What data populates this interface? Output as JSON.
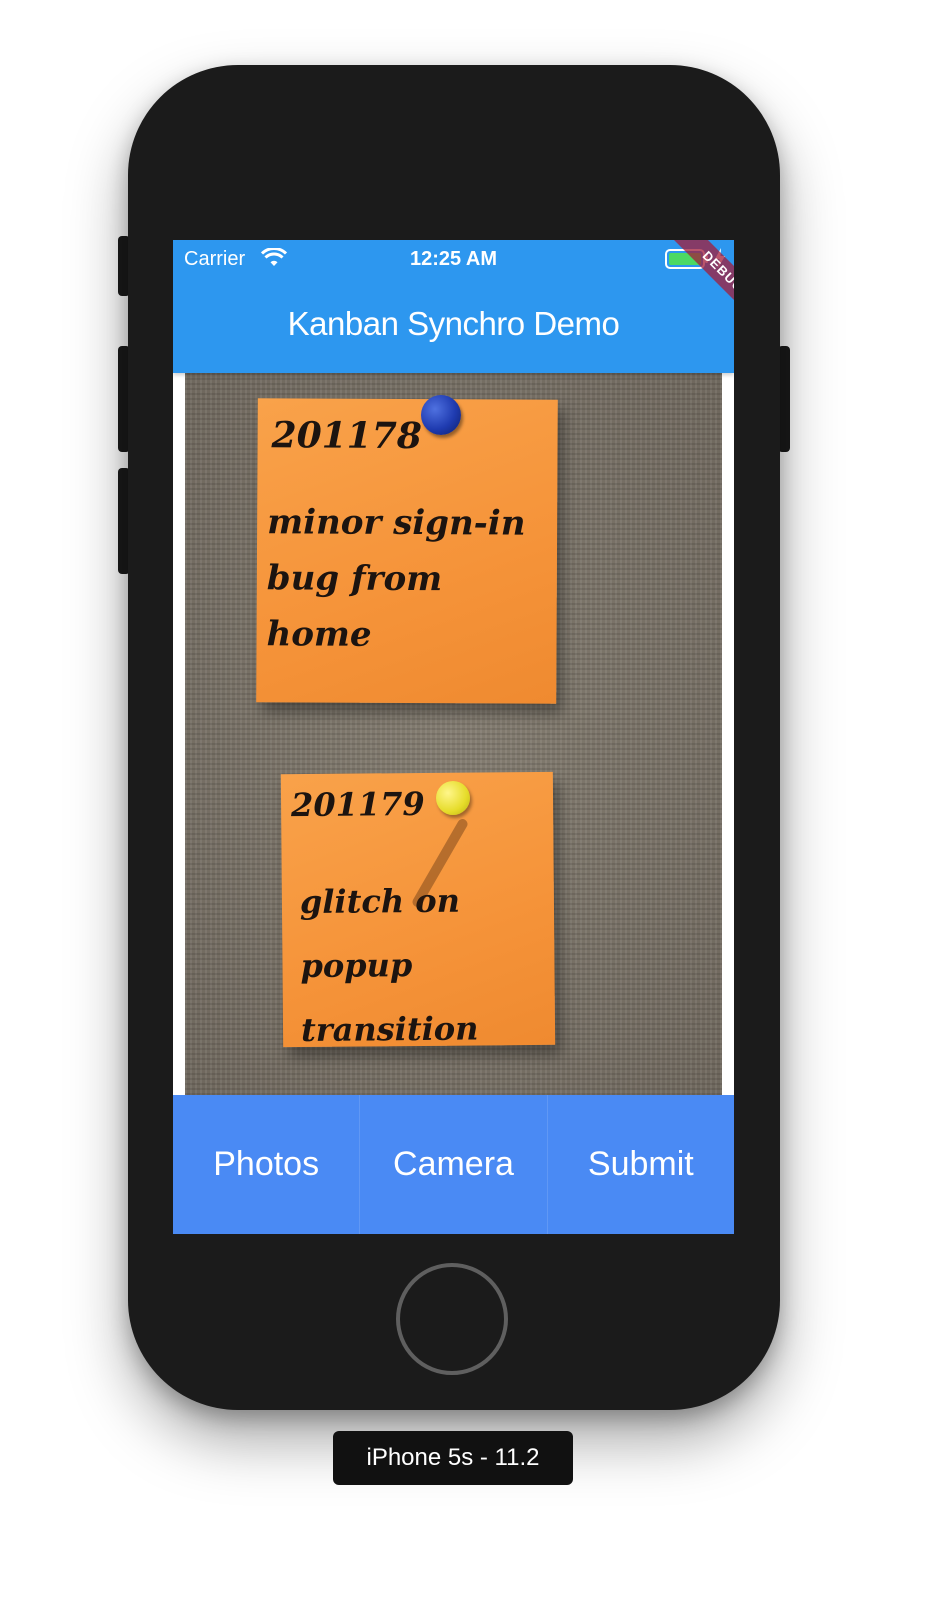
{
  "status_bar": {
    "carrier": "Carrier",
    "time": "12:25 AM"
  },
  "app_bar": {
    "title": "Kanban Synchro Demo"
  },
  "debug_banner": "DEBUG",
  "photo": {
    "notes": [
      {
        "id": "201178",
        "text": "minor sign-in bug from home"
      },
      {
        "id": "201179",
        "text": "glitch on popup transition"
      }
    ]
  },
  "buttons": {
    "photos": "Photos",
    "camera": "Camera",
    "submit": "Submit"
  },
  "device_label": "iPhone 5s - 11.2",
  "colors": {
    "app_bar": "#2d97ef",
    "button_bar": "#4a8af4",
    "note": "#f59339",
    "phone_body": "#1b1b1b"
  }
}
